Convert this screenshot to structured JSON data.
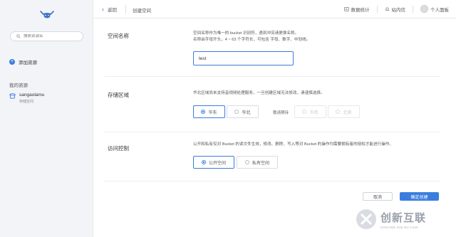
{
  "sidebar": {
    "search_placeholder": "搜索资源名",
    "add_resource": "添加资源",
    "my_resources": "我的资源",
    "resource": {
      "name": "sangaolamu",
      "type": "存储空间"
    }
  },
  "topbar": {
    "back_label": "返回",
    "page_title": "创建空间",
    "data_stats": "数据统计",
    "messages": "站内信",
    "personal_panel": "个人面板"
  },
  "form": {
    "space_name": {
      "label": "空间名称",
      "desc_line1": "空间名称作为唯一的 bucket 识别符，遇到冲突请更换名称。",
      "desc_line2": "名称由字母开头，4 ~ 63 个字符长，可包含 字母、数字、中划线。",
      "value": "test"
    },
    "region": {
      "label": "存储区域",
      "desc": "华北区域尚未支持音视频处理服务，一旦创建区域无法修改，请谨慎选择。",
      "options": [
        "华东",
        "华北"
      ],
      "selected": "华东",
      "coming_label": "敬请期待",
      "coming_options": [
        "华南",
        "北美"
      ]
    },
    "access": {
      "label": "访问控制",
      "desc": "公开和私有仅对 Bucket 的读文件生效，修改、删除、写入等对 Bucket 的操作均需要拥有者的授权才能进行操作。",
      "options": [
        "公开空间",
        "私有空间"
      ],
      "selected": "公开空间"
    }
  },
  "footer": {
    "cancel": "取消",
    "confirm": "确定创建"
  },
  "watermark": {
    "text": "创新互联",
    "sub": "CHUANG XIN HU LIAN"
  },
  "colors": {
    "accent": "#3b7ddd",
    "sidebar_bg": "#f3f4f7"
  }
}
